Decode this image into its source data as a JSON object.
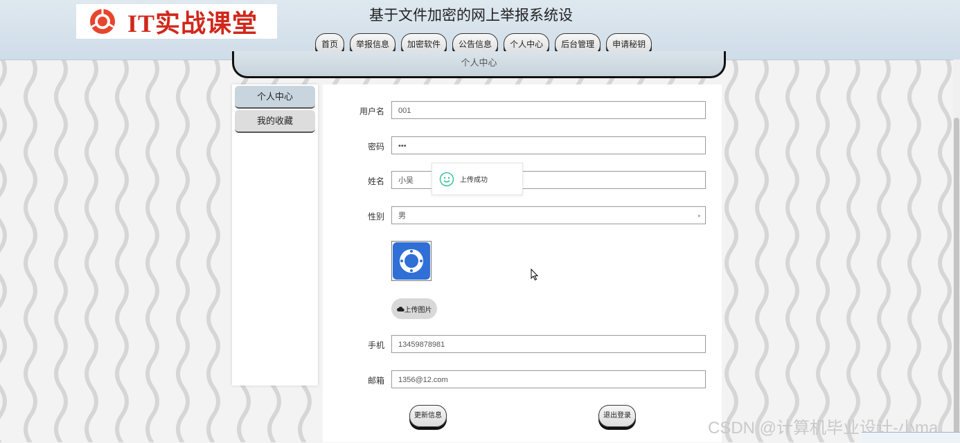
{
  "header": {
    "logo_text": "IT实战课堂",
    "site_title": "基于文件加密的网上举报系统设"
  },
  "nav": {
    "items": [
      {
        "label": "首页"
      },
      {
        "label": "举报信息"
      },
      {
        "label": "加密软件"
      },
      {
        "label": "公告信息"
      },
      {
        "label": "个人中心"
      },
      {
        "label": "后台管理"
      },
      {
        "label": "申请秘钥"
      }
    ]
  },
  "breadcrumb": {
    "title": "个人中心"
  },
  "sidebar": {
    "items": [
      {
        "label": "个人中心",
        "active": true
      },
      {
        "label": "我的收藏",
        "active": false
      }
    ]
  },
  "form": {
    "username": {
      "label": "用户名",
      "value": "001"
    },
    "password": {
      "label": "密码",
      "value": "•••"
    },
    "name": {
      "label": "姓名",
      "value": "小吴"
    },
    "gender": {
      "label": "性别",
      "value": "男"
    },
    "avatar": {
      "icon": "lifebuoy-app-icon",
      "color": "#2f6fd6"
    },
    "upload_label": "上传图片",
    "phone": {
      "label": "手机",
      "value": "13459878981"
    },
    "email": {
      "label": "邮箱",
      "value": "1356@12.com"
    },
    "update_label": "更新信息",
    "logout_label": "退出登录"
  },
  "toast": {
    "message": "上传成功",
    "icon": "smile-icon"
  },
  "watermark": "CSDN @计算机毕业设计-小ma",
  "colors": {
    "logo_red": "#d0281b",
    "toast_green": "#3cbfa3"
  }
}
